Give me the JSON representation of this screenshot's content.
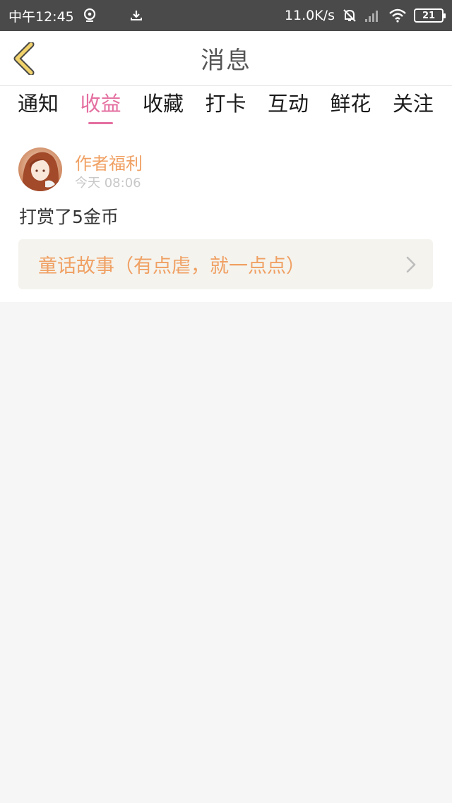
{
  "status_bar": {
    "time": "中午12:45",
    "network_speed": "11.0K/s",
    "battery_level": "21",
    "icons": [
      "location-icon",
      "download-icon",
      "mute-icon",
      "signal-icon",
      "wifi-icon",
      "battery-icon"
    ]
  },
  "nav": {
    "title": "消息",
    "back_icon": "chevron-left-icon",
    "back_color": "#f1d26b"
  },
  "tabs": [
    {
      "label": "通知",
      "active": false
    },
    {
      "label": "收益",
      "active": true
    },
    {
      "label": "收藏",
      "active": false
    },
    {
      "label": "打卡",
      "active": false
    },
    {
      "label": "互动",
      "active": false
    },
    {
      "label": "鲜花",
      "active": false
    },
    {
      "label": "关注",
      "active": false
    }
  ],
  "message": {
    "sender": "作者福利",
    "time": "今天 08:06",
    "text": "打赏了5金币",
    "story_title": "童话故事（有点虐，就一点点）",
    "story_icon": "chevron-right-icon"
  },
  "colors": {
    "accent_pink": "#e46fa0",
    "accent_orange": "#f0a063",
    "status_bar_bg": "#4a4a4a"
  }
}
